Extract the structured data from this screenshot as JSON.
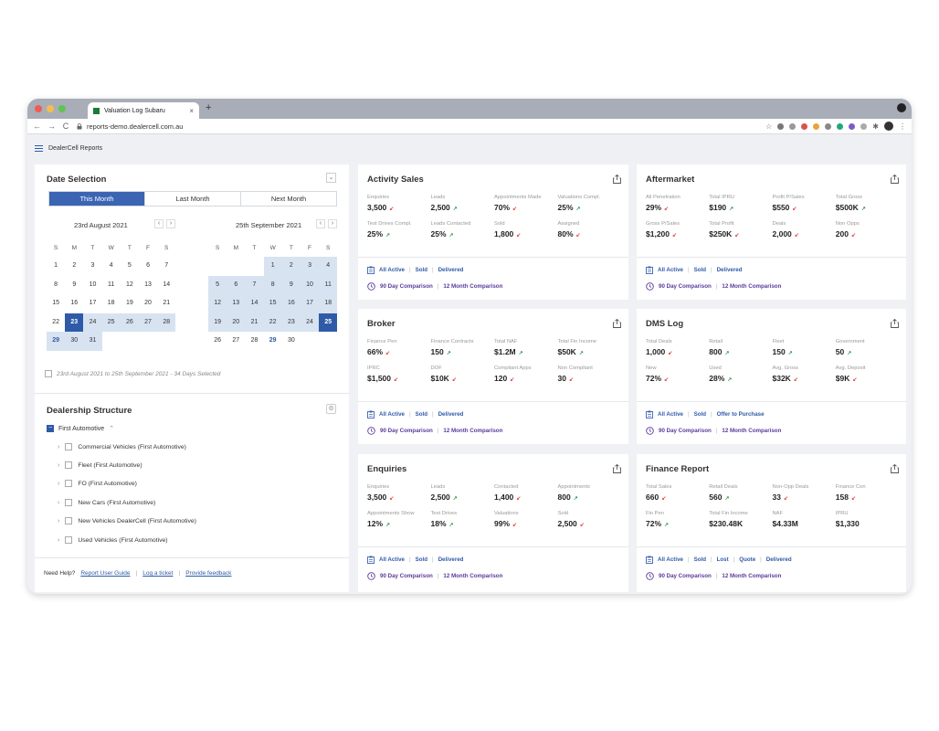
{
  "browser": {
    "tab_title": "Valuation Log Subaru",
    "tab_close": "×",
    "new_tab": "+",
    "url": "reports-demo.dealercell.com.au",
    "nav_back": "←",
    "nav_forward": "→",
    "nav_reload": "C"
  },
  "app": {
    "title": "DealerCell Reports"
  },
  "date_selection": {
    "title": "Date Selection",
    "tabs": [
      "This Month",
      "Last Month",
      "Next Month"
    ],
    "left_month": "23rd August 2021",
    "right_month": "25th September 2021",
    "weekdays": [
      "S",
      "M",
      "T",
      "W",
      "T",
      "F",
      "S"
    ],
    "range_note": "23rd August 2021 to 25th September 2021 - 34 Days Selected"
  },
  "dealership": {
    "title": "Dealership Structure",
    "root": "First Automotive",
    "items": [
      "Commercial Vehicles (First Automotive)",
      "Fleet (First Automotive)",
      "FO (First Automotive)",
      "New Cars (First Automotive)",
      "New Vehicles DealerCell (First Automotive)",
      "Used Vehicles (First Automotive)"
    ]
  },
  "help": {
    "label": "Need Help?",
    "links": [
      "Report User Guide",
      "Log a ticket",
      "Provide feedback"
    ]
  },
  "comparisons": [
    "90 Day Comparison",
    "12 Month Comparison"
  ],
  "cards": {
    "activity_sales": {
      "title": "Activity Sales",
      "metrics": [
        {
          "label": "Enquiries",
          "value": "3,500",
          "trend": "down"
        },
        {
          "label": "Leads",
          "value": "2,500",
          "trend": "up"
        },
        {
          "label": "Appointments Made",
          "value": "70%",
          "trend": "down"
        },
        {
          "label": "Valuations Compl.",
          "value": "25%",
          "trend": "up"
        },
        {
          "label": "Test Drives Compl.",
          "value": "25%",
          "trend": "up"
        },
        {
          "label": "Leads Contacted",
          "value": "25%",
          "trend": "up"
        },
        {
          "label": "Sold",
          "value": "1,800",
          "trend": "down"
        },
        {
          "label": "Assigned",
          "value": "80%",
          "trend": "down"
        }
      ],
      "filters": [
        "All Active",
        "Sold",
        "Delivered"
      ]
    },
    "aftermarket": {
      "title": "Aftermarket",
      "metrics": [
        {
          "label": "All Penetration",
          "value": "29%",
          "trend": "down"
        },
        {
          "label": "Total IPRU",
          "value": "$190",
          "trend": "up"
        },
        {
          "label": "Profit P/Sales",
          "value": "$550",
          "trend": "down"
        },
        {
          "label": "Total Gross",
          "value": "$500K",
          "trend": "up"
        },
        {
          "label": "Gross P/Sales",
          "value": "$1,200",
          "trend": "down"
        },
        {
          "label": "Total Profit",
          "value": "$250K",
          "trend": "down"
        },
        {
          "label": "Deals",
          "value": "2,000",
          "trend": "down"
        },
        {
          "label": "Non Opps",
          "value": "200",
          "trend": "down"
        }
      ],
      "filters": [
        "All Active",
        "Sold",
        "Delivered"
      ]
    },
    "broker": {
      "title": "Broker",
      "metrics": [
        {
          "label": "Finance Pen",
          "value": "66%",
          "trend": "down"
        },
        {
          "label": "Finance Contracts",
          "value": "150",
          "trend": "up"
        },
        {
          "label": "Total NAF",
          "value": "$1.2M",
          "trend": "up"
        },
        {
          "label": "Total Fin Income",
          "value": "$50K",
          "trend": "up"
        },
        {
          "label": "IPRC",
          "value": "$1,500",
          "trend": "down"
        },
        {
          "label": "DOF",
          "value": "$10K",
          "trend": "down"
        },
        {
          "label": "Compliant Apps",
          "value": "120",
          "trend": "down"
        },
        {
          "label": "Non Compliant",
          "value": "30",
          "trend": "down"
        }
      ],
      "filters": [
        "All Active",
        "Sold",
        "Delivered"
      ]
    },
    "dms_log": {
      "title": "DMS Log",
      "metrics": [
        {
          "label": "Total Deals",
          "value": "1,000",
          "trend": "down"
        },
        {
          "label": "Retail",
          "value": "800",
          "trend": "up"
        },
        {
          "label": "Fleet",
          "value": "150",
          "trend": "up"
        },
        {
          "label": "Government",
          "value": "50",
          "trend": "up"
        },
        {
          "label": "New",
          "value": "72%",
          "trend": "down"
        },
        {
          "label": "Used",
          "value": "28%",
          "trend": "up"
        },
        {
          "label": "Avg. Gross",
          "value": "$32K",
          "trend": "down"
        },
        {
          "label": "Avg. Deposit",
          "value": "$9K",
          "trend": "down"
        }
      ],
      "filters": [
        "All Active",
        "Sold",
        "Offer to Purchase"
      ]
    },
    "enquiries": {
      "title": "Enquiries",
      "metrics": [
        {
          "label": "Enquiries",
          "value": "3,500",
          "trend": "down"
        },
        {
          "label": "Leads",
          "value": "2,500",
          "trend": "up"
        },
        {
          "label": "Contacted",
          "value": "1,400",
          "trend": "down"
        },
        {
          "label": "Appointments",
          "value": "800",
          "trend": "up"
        },
        {
          "label": "Appointments Show",
          "value": "12%",
          "trend": "up"
        },
        {
          "label": "Test Drives",
          "value": "18%",
          "trend": "up"
        },
        {
          "label": "Valuations",
          "value": "99%",
          "trend": "down"
        },
        {
          "label": "Sold",
          "value": "2,500",
          "trend": "down"
        }
      ],
      "filters": [
        "All Active",
        "Sold",
        "Delivered"
      ]
    },
    "finance_report": {
      "title": "Finance Report",
      "metrics": [
        {
          "label": "Total Sales",
          "value": "660",
          "trend": "down"
        },
        {
          "label": "Retail Deals",
          "value": "560",
          "trend": "up"
        },
        {
          "label": "Non-Opp Deals",
          "value": "33",
          "trend": "down"
        },
        {
          "label": "Finance Con",
          "value": "158",
          "trend": "down"
        },
        {
          "label": "Fin Pen",
          "value": "72%",
          "trend": "up"
        },
        {
          "label": "Total Fin Income",
          "value": "$230.48K",
          "trend": ""
        },
        {
          "label": "NAF",
          "value": "$4.33M",
          "trend": ""
        },
        {
          "label": "IPRU",
          "value": "$1,330",
          "trend": ""
        }
      ],
      "filters": [
        "All Active",
        "Sold",
        "Lost",
        "Quote",
        "Delivered"
      ]
    }
  },
  "colors": {
    "accent": "#3b64b3",
    "range": "#d8e3f1",
    "comparison": "#5b3a9a",
    "up": "#2f9a47",
    "down": "#e24b4b"
  }
}
